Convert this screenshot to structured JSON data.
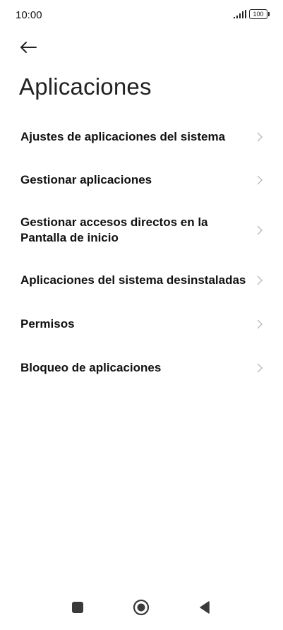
{
  "status_bar": {
    "time": "10:00",
    "battery": "100"
  },
  "header": {
    "title": "Aplicaciones"
  },
  "menu": {
    "items": [
      {
        "label": "Ajustes de aplicaciones del sistema"
      },
      {
        "label": "Gestionar aplicaciones"
      },
      {
        "label": "Gestionar accesos directos en la Pantalla de inicio"
      },
      {
        "label": "Aplicaciones del sistema desinstaladas"
      },
      {
        "label": "Permisos"
      },
      {
        "label": "Bloqueo de aplicaciones"
      }
    ]
  },
  "icons": {
    "back": "back-arrow-icon",
    "chevron": "chevron-right-icon",
    "signal": "signal-icon",
    "battery": "battery-icon",
    "nav_recents": "square-icon",
    "nav_home": "circle-icon",
    "nav_back": "triangle-back-icon"
  }
}
